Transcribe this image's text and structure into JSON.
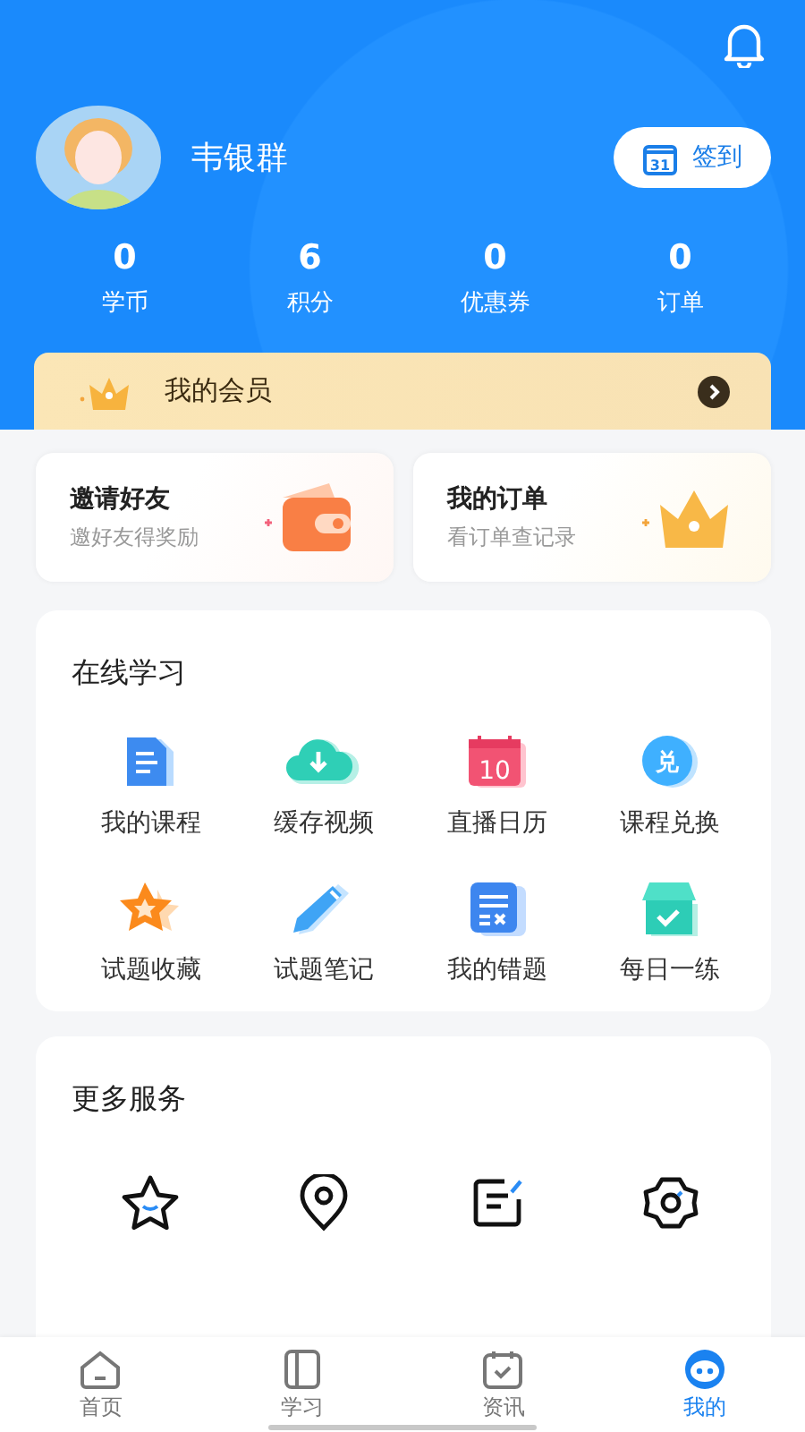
{
  "header": {
    "name": "韦银群",
    "checkin_button": {
      "label": "签到",
      "icon_text": "31"
    },
    "stats": [
      {
        "value": "0",
        "label": "学币"
      },
      {
        "value": "6",
        "label": "积分"
      },
      {
        "value": "0",
        "label": "优惠券"
      },
      {
        "value": "0",
        "label": "订单"
      }
    ]
  },
  "member_bar": {
    "label": "我的会员"
  },
  "promo_cards": [
    {
      "title": "邀请好友",
      "subtitle": "邀好友得奖励",
      "kind": "wallet"
    },
    {
      "title": "我的订单",
      "subtitle": "看订单查记录",
      "kind": "crown"
    }
  ],
  "online_learning": {
    "title": "在线学习",
    "items": [
      {
        "label": "我的课程",
        "kind": "document"
      },
      {
        "label": "缓存视频",
        "kind": "cloud"
      },
      {
        "label": "直播日历",
        "kind": "calendar",
        "icon_text": "10"
      },
      {
        "label": "课程兑换",
        "kind": "coin",
        "icon_text": "兑"
      },
      {
        "label": "试题收藏",
        "kind": "star"
      },
      {
        "label": "试题笔记",
        "kind": "pencil"
      },
      {
        "label": "我的错题",
        "kind": "wrong"
      },
      {
        "label": "每日一练",
        "kind": "shop"
      }
    ]
  },
  "more_services": {
    "title": "更多服务",
    "items": [
      {
        "kind": "star-outline"
      },
      {
        "kind": "location"
      },
      {
        "kind": "feedback"
      },
      {
        "kind": "settings"
      }
    ]
  },
  "tab_bar": {
    "tabs": [
      {
        "label": "首页",
        "kind": "home",
        "selected": false
      },
      {
        "label": "学习",
        "kind": "book",
        "selected": false
      },
      {
        "label": "资讯",
        "kind": "news",
        "selected": false
      },
      {
        "label": "我的",
        "kind": "face",
        "selected": true
      }
    ]
  }
}
